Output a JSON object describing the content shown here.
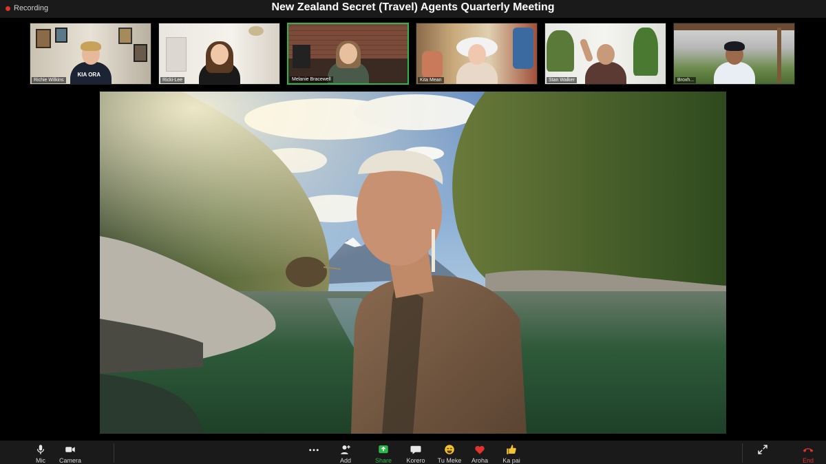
{
  "recording": {
    "label": "Recording"
  },
  "meeting": {
    "title": "New Zealand Secret (Travel) Agents Quarterly Meeting"
  },
  "participants": [
    {
      "name": "Richie Wilkins",
      "shirt_text": "KIA ORA"
    },
    {
      "name": "Ricki-Lee"
    },
    {
      "name": "Melanie Bracewell"
    },
    {
      "name": "Kita Mean"
    },
    {
      "name": "Stan Walker"
    },
    {
      "name": "Broxh..."
    }
  ],
  "toolbar": {
    "mic": "Mic",
    "camera": "Camera",
    "more": "",
    "add": "Add",
    "share": "Share",
    "korero": "Korero",
    "tu_meke": "Tu Meke",
    "aroha": "Aroha",
    "ka_pai": "Ka pai",
    "end": "End"
  },
  "colors": {
    "accent_green": "#2fb64a",
    "record_red": "#e0322e",
    "bar_bg": "#1a1a1a"
  }
}
